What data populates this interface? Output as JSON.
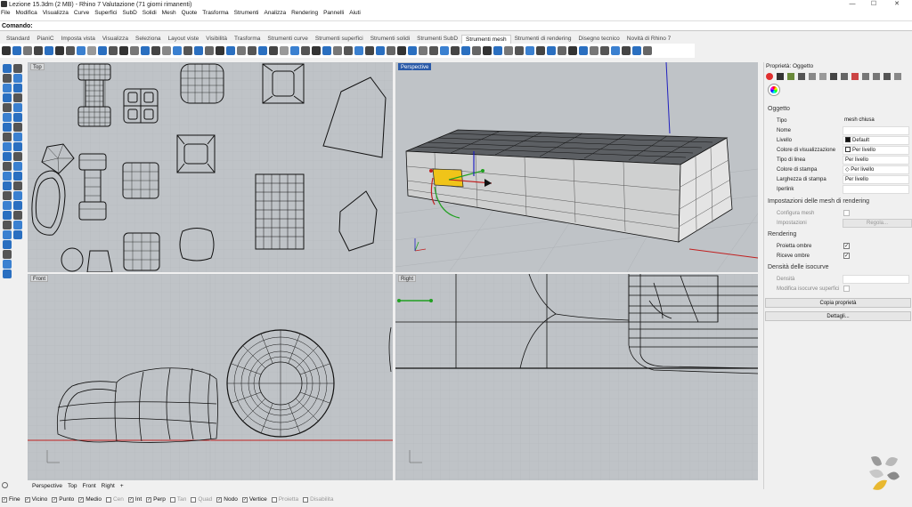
{
  "window": {
    "title": "Lezione 15.3dm (2 MB) - Rhino 7 Valutazione (71 giorni rimanenti)",
    "minimize": "—",
    "maximize": "☐",
    "close": "✕"
  },
  "menu": [
    "File",
    "Modifica",
    "Visualizza",
    "Curve",
    "Superfici",
    "SubD",
    "Solidi",
    "Mesh",
    "Quote",
    "Trasforma",
    "Strumenti",
    "Analizza",
    "Rendering",
    "Pannelli",
    "Aiuti"
  ],
  "command": {
    "label": "Comando:",
    "value": ""
  },
  "toolbar_tabs": [
    "Standard",
    "PianiC",
    "Imposta vista",
    "Visualizza",
    "Seleziona",
    "Layout viste",
    "Visibilità",
    "Trasforma",
    "Strumenti curve",
    "Strumenti superfici",
    "Strumenti solidi",
    "Strumenti SubD",
    "Strumenti mesh",
    "Strumenti di rendering",
    "Disegno tecnico",
    "Novità di Rhino 7"
  ],
  "active_tab": "Strumenti mesh",
  "viewports": {
    "top": "Top",
    "perspective": "Perspective",
    "front": "Front",
    "right": "Right"
  },
  "properties": {
    "title": "Proprietà: Oggetto",
    "object_header": "Oggetto",
    "rows": [
      {
        "label": "Tipo",
        "value": "mesh chiusa"
      },
      {
        "label": "Nome",
        "value": ""
      },
      {
        "label": "Livello",
        "value": "Default"
      },
      {
        "label": "Colore di visualizzazione",
        "value": "Per livello"
      },
      {
        "label": "Tipo di linea",
        "value": "Per livello"
      },
      {
        "label": "Colore di stampa",
        "value": "Per livello"
      },
      {
        "label": "Larghezza di stampa",
        "value": "Per livello"
      },
      {
        "label": "Iperlink",
        "value": ""
      }
    ],
    "mesh_header": "Impostazioni delle mesh di rendering",
    "configure_mesh": "Configura mesh",
    "settings": "Impostazioni",
    "settings_button": "Regola...",
    "rendering_header": "Rendering",
    "cast_shadows": "Proietta ombre",
    "receive_shadows": "Riceve ombre",
    "isocurve_header": "Densità delle isocurve",
    "density": "Densità",
    "modify_isocurve": "Modifica isocurve superfici",
    "copy_button": "Copia proprietà",
    "details_button": "Dettagli..."
  },
  "viewport_tabs": [
    "Perspective",
    "Top",
    "Front",
    "Right",
    "+"
  ],
  "osnaps": [
    {
      "label": "Fine",
      "checked": true
    },
    {
      "label": "Vicino",
      "checked": true
    },
    {
      "label": "Punto",
      "checked": true
    },
    {
      "label": "Medio",
      "checked": true
    },
    {
      "label": "Cen",
      "checked": false
    },
    {
      "label": "Int",
      "checked": true
    },
    {
      "label": "Perp",
      "checked": true
    },
    {
      "label": "Tan",
      "checked": false
    },
    {
      "label": "Quad",
      "checked": false
    },
    {
      "label": "Nodo",
      "checked": true
    },
    {
      "label": "Vertice",
      "checked": true
    },
    {
      "label": "Proietta",
      "checked": false
    },
    {
      "label": "Disabilita",
      "checked": false
    }
  ],
  "colors": {
    "viewport_bg": "#bfc3c7",
    "active_label": "#2a5aa8",
    "selection": "#f0c419",
    "x_axis": "#c02020",
    "y_axis": "#20a020",
    "z_axis": "#2020c0"
  }
}
